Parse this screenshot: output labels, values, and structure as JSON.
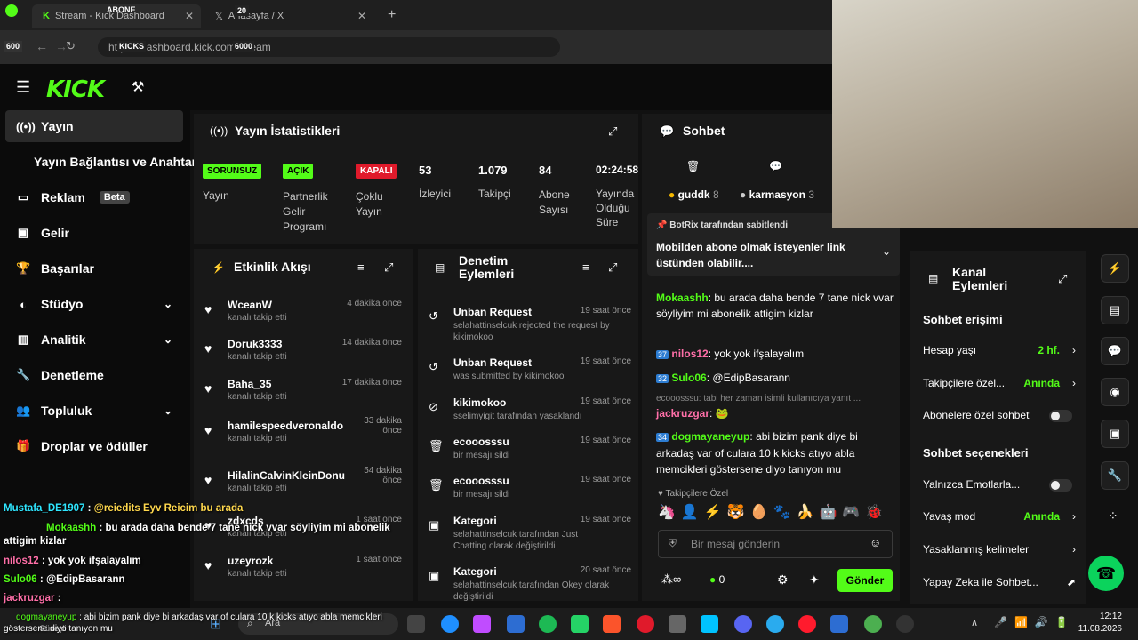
{
  "browser": {
    "tab1": "Stream - Kick Dashboard",
    "tab2": "Anasayfa / X",
    "url": "https://dashboard.kick.com/stream",
    "abone_badge": "ABONE",
    "abone_count": "20",
    "kicks_label": "KICKS",
    "kicks_count": "6000",
    "left_badge": "600"
  },
  "sidebar": {
    "items": [
      {
        "label": "Yayın"
      },
      {
        "label": "Yayın Bağlantısı ve Anahtarı"
      },
      {
        "label": "Reklam",
        "badge": "Beta"
      },
      {
        "label": "Gelir"
      },
      {
        "label": "Başarılar"
      },
      {
        "label": "Stüdyo"
      },
      {
        "label": "Analitik"
      },
      {
        "label": "Denetleme"
      },
      {
        "label": "Topluluk"
      },
      {
        "label": "Droplar ve ödüller"
      }
    ]
  },
  "stats": {
    "title": "Yayın İstatistikleri",
    "items": [
      {
        "badge": "SORUNSUZ",
        "label": "Yayın"
      },
      {
        "badge": "AÇIK",
        "label": "Partnerlik Gelir Programı"
      },
      {
        "badge": "KAPALI",
        "label": "Çoklu Yayın"
      },
      {
        "value": "53",
        "label": "İzleyici"
      },
      {
        "value": "1.079",
        "label": "Takipçi"
      },
      {
        "value": "84",
        "label": "Abone Sayısı"
      },
      {
        "value": "02:24:58",
        "label": "Yayında Olduğu Süre"
      }
    ]
  },
  "activity": {
    "title": "Etkinlik Akışı",
    "items": [
      {
        "name": "WceanW",
        "sub": "kanalı takip etti",
        "time": "4 dakika önce"
      },
      {
        "name": "Doruk3333",
        "sub": "kanalı takip etti",
        "time": "14 dakika önce"
      },
      {
        "name": "Baha_35",
        "sub": "kanalı takip etti",
        "time": "17 dakika önce"
      },
      {
        "name": "hamilespeedveronaldo",
        "sub": "kanalı takip etti",
        "time": "33 dakika önce"
      },
      {
        "name": "HilalinCalvinKleinDonu",
        "sub": "kanalı takip etti",
        "time": "54 dakika önce"
      },
      {
        "name": "zdxcds",
        "sub": "kanalı takip etti",
        "time": "1 saat önce"
      },
      {
        "name": "uzeyrozk",
        "sub": "kanalı takip etti",
        "time": "1 saat önce"
      }
    ]
  },
  "moderation": {
    "title": "Denetim Eylemleri",
    "items": [
      {
        "name": "Unban Request",
        "sub": "selahattinselcuk rejected the request by kikimokoo",
        "time": "19 saat önce"
      },
      {
        "name": "Unban Request",
        "sub": "was submitted by kikimokoo",
        "time": "19 saat önce"
      },
      {
        "name": "kikimokoo",
        "sub": "sselimyigit tarafından yasaklandı",
        "time": "19 saat önce"
      },
      {
        "name": "ecooosssu",
        "sub": "bir mesajı sildi",
        "time": "19 saat önce"
      },
      {
        "name": "ecooosssu",
        "sub": "bir mesajı sildi",
        "time": "19 saat önce"
      },
      {
        "name": "Kategori",
        "sub": "selahattinselcuk tarafından Just Chatting olarak değiştirildi",
        "time": "19 saat önce"
      },
      {
        "name": "Kategori",
        "sub": "selahattinselcuk tarafından Okey olarak değiştirildi",
        "time": "20 saat önce"
      }
    ]
  },
  "chat": {
    "title": "Sohbet",
    "top1": "guddk",
    "top1n": "8",
    "top2": "karmasyon",
    "top2n": "3",
    "pinned_by": "BotRix tarafından sabitlendi",
    "pinned": "Mobilden abone olmak isteyenler link üstünden olabilir....",
    "messages": [
      {
        "user": "Mokaashh",
        "text": "bu arada daha bende 7 tane nick vvar söyliyim mi abonelik attigim kizlar"
      },
      {
        "badge": "37",
        "user": "nilos12",
        "text": "yok yok ifşalayalım"
      },
      {
        "badge": "32",
        "user": "Sulo06",
        "text": "@EdipBasarann"
      },
      {
        "reply": "ecooosssu: tabi her zaman isimli kullanıcıya yanıt ...",
        "user": "jackruzgar",
        "text": ""
      },
      {
        "badge": "34",
        "user": "dogmayaneyup",
        "text": "abi bizim pank diye bi arkadaş var of culara 10 k kicks atıyo abla memcikleri göstersene diyo tanıyon mu"
      }
    ],
    "followers_only": "Takipçilere Özel",
    "placeholder": "Bir mesaj gönderin",
    "kicks": "0",
    "send": "Gönder"
  },
  "channel": {
    "title": "Kanal Eylemleri",
    "sec1": "Sohbet erişimi",
    "opts1": [
      {
        "label": "Hesap yaşı",
        "value": "2 hf."
      },
      {
        "label": "Takipçilere özel...",
        "value": "Anında"
      },
      {
        "label": "Abonelere özel sohbet"
      }
    ],
    "sec2": "Sohbet seçenekleri",
    "opts2": [
      {
        "label": "Yalnızca Emotlarla..."
      },
      {
        "label": "Yavaş mod",
        "value": "Anında"
      },
      {
        "label": "Yasaklanmış kelimeler"
      },
      {
        "label": "Yapay Zeka ile Sohbet..."
      }
    ]
  },
  "overlay": [
    {
      "user": "Mustafa_DE1907",
      "text": "@reiedits Eyv Reicim bu arada"
    },
    {
      "user": "Mokaashh",
      "text": "bu arada daha bende 7 tane nick vvar söyliyim mi abonelik attigim kizlar"
    },
    {
      "user": "nilos12",
      "text": "yok yok ifşalayalım"
    },
    {
      "user": "Sulo06",
      "text": "@EdipBasarann"
    },
    {
      "user": "jackruzgar",
      "text": ""
    },
    {
      "user": "dogmayaneyup",
      "text": "abi bizim pank diye bi arkadaş var of culara 10 k kicks atıyo abla memcikleri göstersene diyo tanıyon mu"
    }
  ],
  "taskbar": {
    "weather": "Güneşli",
    "search": "Ara",
    "time": "12:12",
    "date": "11.08.2026"
  },
  "colors": {
    "accent": "#53fc18"
  }
}
